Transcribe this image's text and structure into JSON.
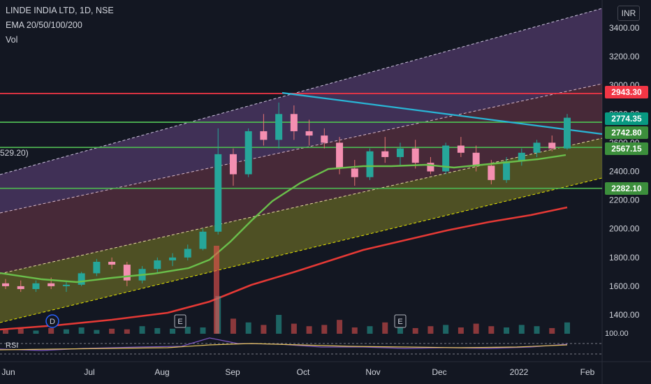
{
  "header": {
    "symbol_line": "LINDE INDIA LTD, 1D, NSE",
    "indicator_line": "EMA 20/50/100/200",
    "vol_label": "Vol"
  },
  "currency_button": "INR",
  "ema_value_fragment": "529.20)",
  "rsi": {
    "label": "RSI",
    "value_fragment": "100.00"
  },
  "event_markers": [
    {
      "label": "D",
      "date": "Jun 15"
    },
    {
      "label": "E",
      "date": "Aug 12"
    },
    {
      "label": "E",
      "date": "Nov 12"
    }
  ],
  "price_tags": [
    {
      "value": "2943.30",
      "color": "#f23645"
    },
    {
      "value": "2774.35",
      "color": "#089981"
    },
    {
      "value": "2742.80",
      "color": "#3c8f3c"
    },
    {
      "value": "2567.15",
      "color": "#3c8f3c"
    },
    {
      "value": "2282.10",
      "color": "#3c8f3c"
    }
  ],
  "colors": {
    "background": "#131722",
    "up": "#26a69a",
    "down": "#ef5350",
    "resistance": "#f23645",
    "support": "#4caf50",
    "trendline": "#29b6d6",
    "ema_green": "#6abf4b",
    "ema_red": "#e53935",
    "channel_dash": "#e6e6a0"
  },
  "chart_data": {
    "type": "candlestick",
    "x_ticks": [
      "Jun",
      "Jul",
      "Aug",
      "Sep",
      "Oct",
      "Nov",
      "Dec",
      "2022",
      "Feb"
    ],
    "y_ticks": [
      1400,
      1600,
      1800,
      2000,
      2200,
      2400,
      2600,
      2800,
      3000,
      3200,
      3400
    ],
    "ylim": [
      1400,
      3400
    ],
    "ohlc_weekly": [
      [
        1620,
        1650,
        1580,
        1600
      ],
      [
        1600,
        1640,
        1560,
        1580
      ],
      [
        1580,
        1640,
        1560,
        1620
      ],
      [
        1620,
        1660,
        1580,
        1600
      ],
      [
        1600,
        1640,
        1560,
        1610
      ],
      [
        1610,
        1700,
        1600,
        1690
      ],
      [
        1690,
        1790,
        1670,
        1770
      ],
      [
        1770,
        1800,
        1720,
        1750
      ],
      [
        1750,
        1770,
        1600,
        1640
      ],
      [
        1640,
        1740,
        1620,
        1720
      ],
      [
        1720,
        1800,
        1690,
        1780
      ],
      [
        1780,
        1830,
        1740,
        1800
      ],
      [
        1800,
        1890,
        1780,
        1860
      ],
      [
        1860,
        2000,
        1850,
        1980
      ],
      [
        1980,
        2700,
        1960,
        2520
      ],
      [
        2520,
        2560,
        2300,
        2380
      ],
      [
        2380,
        2700,
        2360,
        2680
      ],
      [
        2680,
        2800,
        2580,
        2620
      ],
      [
        2620,
        2880,
        2560,
        2800
      ],
      [
        2800,
        2860,
        2620,
        2680
      ],
      [
        2680,
        2760,
        2580,
        2650
      ],
      [
        2650,
        2700,
        2560,
        2600
      ],
      [
        2600,
        2640,
        2380,
        2420
      ],
      [
        2420,
        2480,
        2300,
        2360
      ],
      [
        2360,
        2560,
        2340,
        2540
      ],
      [
        2540,
        2640,
        2460,
        2500
      ],
      [
        2500,
        2600,
        2440,
        2560
      ],
      [
        2560,
        2620,
        2420,
        2460
      ],
      [
        2460,
        2500,
        2380,
        2400
      ],
      [
        2400,
        2600,
        2380,
        2580
      ],
      [
        2580,
        2640,
        2500,
        2530
      ],
      [
        2530,
        2580,
        2400,
        2440
      ],
      [
        2440,
        2480,
        2310,
        2340
      ],
      [
        2340,
        2500,
        2320,
        2470
      ],
      [
        2470,
        2560,
        2440,
        2530
      ],
      [
        2530,
        2620,
        2500,
        2600
      ],
      [
        2600,
        2650,
        2540,
        2560
      ],
      [
        2560,
        2800,
        2550,
        2774
      ]
    ],
    "horizontal_levels": [
      2943.3,
      2742.8,
      2567.15,
      2282.1
    ],
    "last_price": 2774.35
  }
}
